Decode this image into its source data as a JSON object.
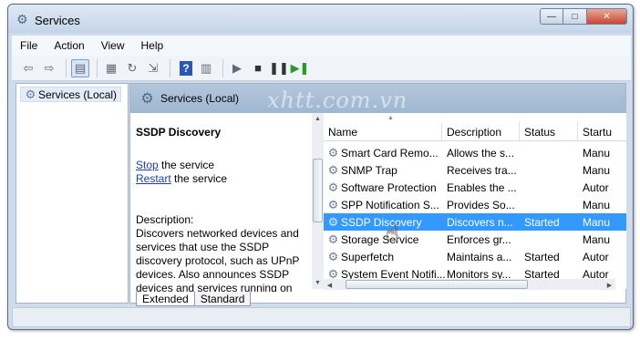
{
  "window": {
    "title": "Services",
    "icon": "services-gear-icon"
  },
  "caption_buttons": {
    "minimize": "—",
    "maximize": "□",
    "close": "✕"
  },
  "menu": [
    "File",
    "Action",
    "View",
    "Help"
  ],
  "toolbar": {
    "back": "⇦",
    "forward": "⇨",
    "show_hide_tree": "▤",
    "properties": "▦",
    "refresh": "↻",
    "export": "⇲",
    "help": "?",
    "console": "▥",
    "start": "▶",
    "stop": "■",
    "pause": "❚❚",
    "restart": "▶❚"
  },
  "tree": {
    "selected_label": "Services (Local)"
  },
  "right_header": {
    "title": "Services (Local)",
    "watermark": "xhtt.com.vn"
  },
  "detail": {
    "service_name": "SSDP Discovery",
    "stop_link": "Stop",
    "stop_suffix": " the service",
    "restart_link": "Restart",
    "restart_suffix": " the service",
    "description_label": "Description:",
    "description_text": "Discovers networked devices and services that use the SSDP discovery protocol, such as UPnP devices. Also announces SSDP devices and services running on"
  },
  "columns": [
    "Name",
    "Description",
    "Status",
    "Startu"
  ],
  "rows": [
    {
      "name": "Smart Card Remo...",
      "description": "Allows the s...",
      "status": "",
      "startup": "Manu"
    },
    {
      "name": "SNMP Trap",
      "description": "Receives tra...",
      "status": "",
      "startup": "Manu"
    },
    {
      "name": "Software Protection",
      "description": "Enables the ...",
      "status": "",
      "startup": "Autor"
    },
    {
      "name": "SPP Notification S...",
      "description": "Provides So...",
      "status": "",
      "startup": "Manu"
    },
    {
      "name": "SSDP Discovery",
      "description": "Discovers n...",
      "status": "Started",
      "startup": "Manu"
    },
    {
      "name": "Storage Service",
      "description": "Enforces gr...",
      "status": "",
      "startup": "Manu"
    },
    {
      "name": "Superfetch",
      "description": "Maintains a...",
      "status": "Started",
      "startup": "Autor"
    },
    {
      "name": "System Event Notifi...",
      "description": "Monitors sy...",
      "status": "Started",
      "startup": "Autor"
    }
  ],
  "selected_row": "SSDP Discovery",
  "tabs": [
    "Extended",
    "Standard"
  ],
  "colors": {
    "selection": "#3399ff",
    "link": "#1b3ea8",
    "header": "#a9bfd6"
  }
}
